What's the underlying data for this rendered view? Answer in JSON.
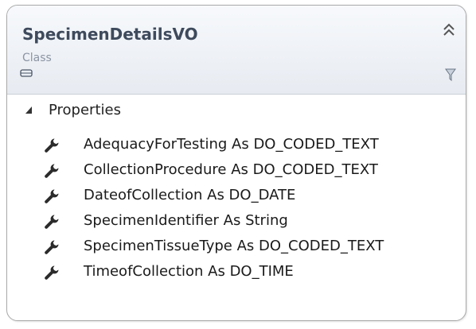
{
  "class_shape": {
    "name": "SpecimenDetailsVO",
    "stereotype": "Class",
    "icons": {
      "collapse": "double-chevron-up-icon",
      "class": "class-icon",
      "filter": "filter-icon"
    }
  },
  "compartment": {
    "label": "Properties",
    "expander_icon": "triangle-expanded-icon",
    "item_icon": "wrench-icon",
    "items": [
      {
        "text": "AdequacyForTesting As DO_CODED_TEXT"
      },
      {
        "text": "CollectionProcedure As DO_CODED_TEXT"
      },
      {
        "text": "DateofCollection As DO_DATE"
      },
      {
        "text": "SpecimenIdentifier As String"
      },
      {
        "text": "SpecimenTissueType As DO_CODED_TEXT"
      },
      {
        "text": "TimeofCollection As DO_TIME"
      }
    ]
  },
  "colors": {
    "title": "#3e4a5c",
    "stereotype": "#8b95a3",
    "border": "#a9a9a9",
    "header_top": "#f7f9fc",
    "header_bottom": "#e7ebf1",
    "icon": "#2b2b2b"
  }
}
